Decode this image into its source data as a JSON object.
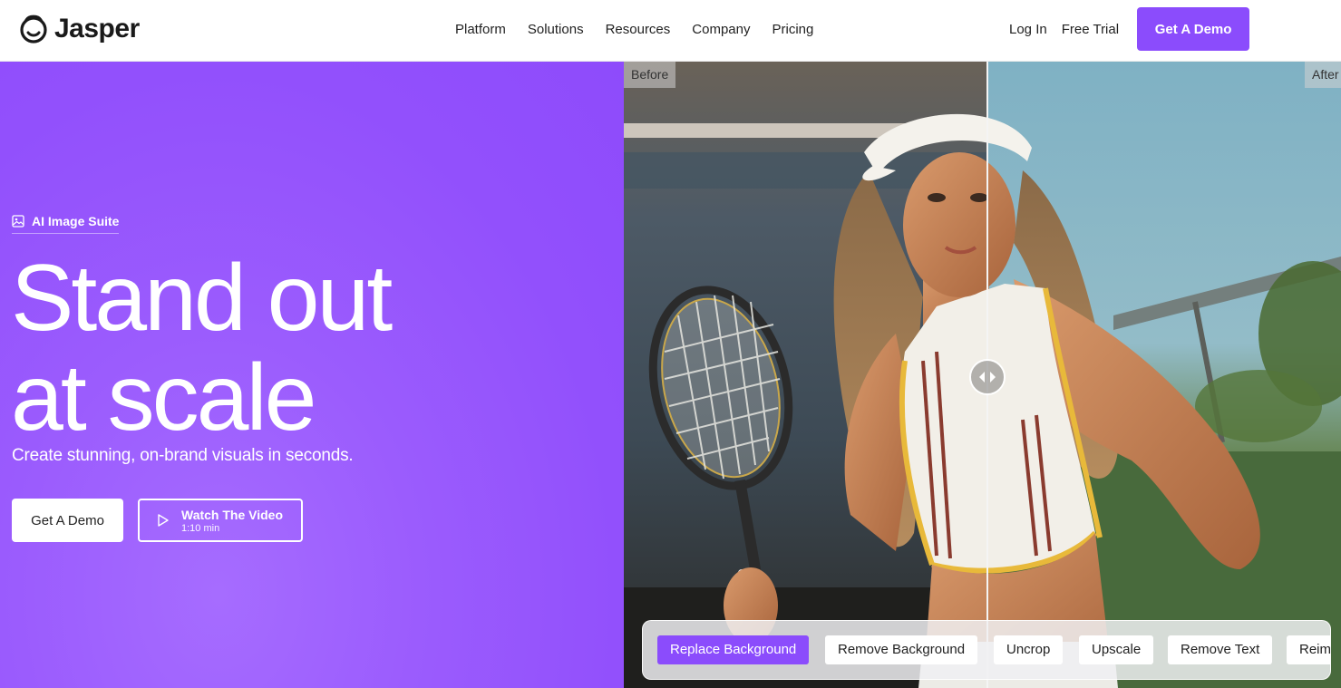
{
  "brand": {
    "name": "Jasper",
    "accent": "#8b4cfc"
  },
  "nav": {
    "links": [
      "Platform",
      "Solutions",
      "Resources",
      "Company",
      "Pricing"
    ],
    "login": "Log In",
    "free_trial": "Free Trial",
    "demo": "Get A Demo"
  },
  "hero": {
    "eyebrow": "AI Image Suite",
    "eyebrow_icon": "image-icon",
    "headline_line1": "Stand out",
    "headline_line2": "at scale",
    "subhead": "Create stunning, on-brand visuals in seconds.",
    "cta_primary": "Get A Demo",
    "cta_video_title": "Watch The Video",
    "cta_video_duration": "1:10 min",
    "cta_video_icon": "play-icon"
  },
  "compare": {
    "before_label": "Before",
    "after_label": "After",
    "handle_icon": "left-right-arrows-icon"
  },
  "tools": {
    "items": [
      "Replace Background",
      "Remove Background",
      "Uncrop",
      "Upscale",
      "Remove Text",
      "Reimagine"
    ],
    "active_index": 0
  }
}
